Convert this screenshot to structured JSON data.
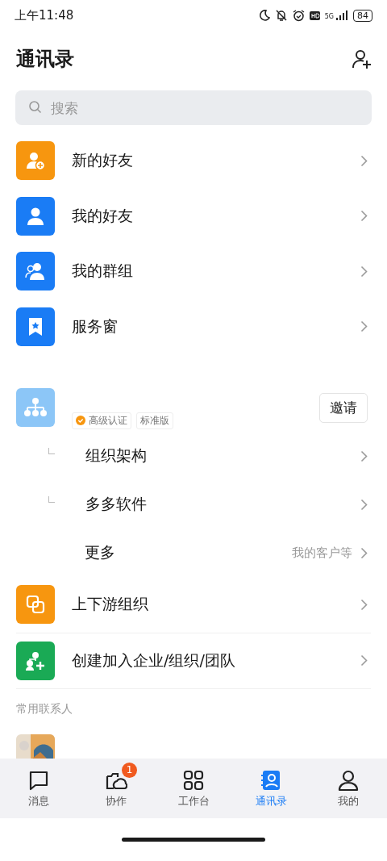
{
  "status_bar": {
    "time": "上午11:48",
    "battery": "84",
    "network": "5G"
  },
  "header": {
    "title": "通讯录"
  },
  "search": {
    "placeholder": "搜索"
  },
  "entries": [
    {
      "label": "新的好友",
      "color": "#f7960f"
    },
    {
      "label": "我的好友",
      "color": "#1a7cf5"
    },
    {
      "label": "我的群组",
      "color": "#1a7cf5"
    },
    {
      "label": "服务窗",
      "color": "#1a7cf5"
    }
  ],
  "organization": {
    "tags": [
      {
        "label": "高级认证",
        "verified": true
      },
      {
        "label": "标准版",
        "verified": false
      }
    ],
    "invite_button": "邀请",
    "children": [
      {
        "label": "组织架构",
        "branch": true
      },
      {
        "label": "多多软件",
        "branch": true
      },
      {
        "label": "更多",
        "branch": false,
        "hint": "我的客户等"
      }
    ]
  },
  "more_entries": [
    {
      "label": "上下游组织",
      "color": "#f7960f"
    },
    {
      "label": "创建加入企业/组织/团队",
      "color": "#1aaa55"
    }
  ],
  "frequent_contacts": {
    "heading": "常用联系人"
  },
  "tab_bar": [
    {
      "label": "消息",
      "selected": false
    },
    {
      "label": "协作",
      "selected": false,
      "badge": "1"
    },
    {
      "label": "工作台",
      "selected": false
    },
    {
      "label": "通讯录",
      "selected": true
    },
    {
      "label": "我的",
      "selected": false
    }
  ]
}
